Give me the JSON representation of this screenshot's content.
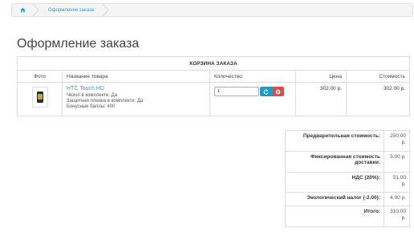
{
  "breadcrumb": {
    "home_icon": "home-icon",
    "current": "Оформление заказа"
  },
  "page": {
    "title": "Оформление заказа"
  },
  "cart": {
    "caption": "КОРЗИНА ЗАКАЗА",
    "headers": {
      "photo": "Фото",
      "name": "Название товара",
      "quantity": "Количество",
      "price": "Цена",
      "total": "Стоимость"
    },
    "items": [
      {
        "name": "HTC Touch HD",
        "options": [
          "Чехол в комплекте: Да",
          "Защитная пленка в комплекте: Да",
          "Бонусные баллы: 400"
        ],
        "quantity": "1",
        "price": "302.00 р.",
        "total": "302.00 р."
      }
    ]
  },
  "totals": [
    {
      "label": "Предварительная стоимость:",
      "value": "250.00 р."
    },
    {
      "label": "Фиксированная стоимость доставки:",
      "value": "5.00 р."
    },
    {
      "label": "НДС (20%):",
      "value": "51.00 р."
    },
    {
      "label": "Экологический налог (-2.00):",
      "value": "4.00 р."
    },
    {
      "label": "Итого:",
      "value": "310.00 р."
    }
  ],
  "colors": {
    "link": "#23a1d1",
    "update_button": "#229ac8",
    "remove_button": "#da4f49"
  }
}
